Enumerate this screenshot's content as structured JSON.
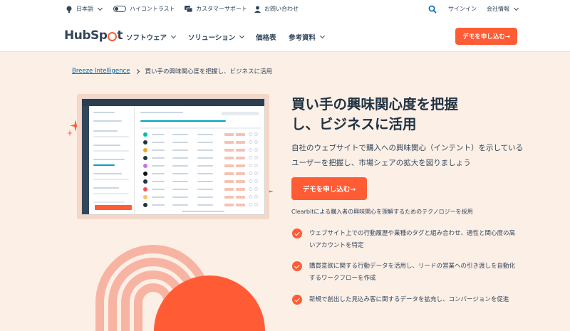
{
  "utility_bar": {
    "language": "日本語",
    "high_contrast": "ハイコントラスト",
    "support": "カスタマーサポート",
    "contact": "お問い合わせ",
    "signin": "サインイン",
    "company": "会社情報"
  },
  "nav": {
    "logo": "HubSpot",
    "logo_pre": "HubSp",
    "logo_post": "t",
    "items": [
      "ソフトウェア",
      "ソリューション",
      "価格表",
      "参考資料"
    ],
    "cta": "デモを申し込む→"
  },
  "breadcrumb": {
    "parent": "Breeze Intelligence",
    "current": "買い手の興味関心度を把握し、ビジネスに活用"
  },
  "hero": {
    "title_line1": "買い手の興味関心度を把握",
    "title_line2": "し、ビジネスに活用",
    "description": "自社のウェブサイトで購入への興味関心（インテント）を示しているユーザーを把握し、市場シェアの拡大を図りましょう",
    "cta": "デモを申し込む→",
    "note": "Clearbitによる購入者の興味関心を理解するためのテクノロジーを採用"
  },
  "bullets": [
    "ウェブサイト上での行動履歴や業種のタグと組み合わせ、適性と関心度の高いアカウントを特定",
    "購買意欲に関する行動データを活用し、リードの営業への引き渡しを自動化するワークフローを作成",
    "新規で創出した見込み客に関するデータを拡充し、コンバージョンを促進"
  ],
  "colors": {
    "accent": "#ff5c35",
    "background": "#fcefe6",
    "text": "#33475b",
    "link": "#0068b1"
  },
  "icons": [
    "globe-icon",
    "toggle-icon",
    "chat-icon",
    "person-icon",
    "search-icon",
    "chevron-down-icon",
    "check-icon",
    "sparkle-icon"
  ]
}
